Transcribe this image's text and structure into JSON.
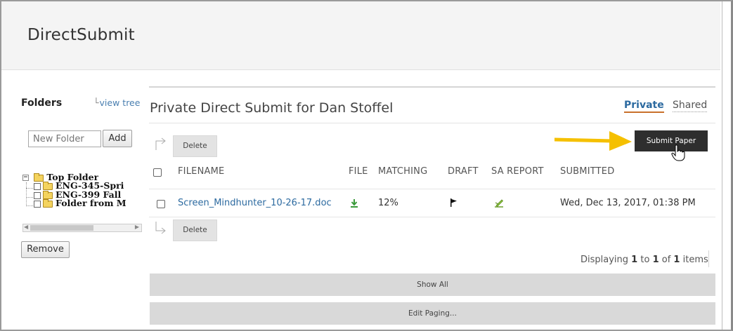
{
  "app": {
    "title": "DirectSubmit"
  },
  "sidebar": {
    "title": "Folders",
    "view_tree_label": "view tree",
    "new_folder_placeholder": "New Folder",
    "add_label": "Add",
    "remove_label": "Remove",
    "tree": {
      "root": "Top Folder",
      "children": [
        "ENG-345-Spri",
        "ENG-399 Fall",
        "Folder from M"
      ]
    }
  },
  "main": {
    "heading": "Private Direct Submit for Dan Stoffel",
    "tabs": [
      {
        "label": "Private",
        "active": true
      },
      {
        "label": "Shared",
        "active": false
      }
    ],
    "delete_label": "Delete",
    "submit_label": "Submit Paper",
    "columns": [
      "FILENAME",
      "FILE",
      "MATCHING",
      "DRAFT",
      "SA REPORT",
      "SUBMITTED"
    ],
    "rows": [
      {
        "filename": "Screen_Mindhunter_10-26-17.doc",
        "file_icon": "download-icon",
        "matching": "12%",
        "draft_icon": "flag-icon",
        "sa_report_icon": "sa-report-icon",
        "submitted": "Wed, Dec 13, 2017, 01:38 PM"
      }
    ],
    "paging": {
      "prefix": "Displaying",
      "from": "1",
      "to_word": "to",
      "to": "1",
      "of_word": "of",
      "total": "1",
      "suffix": "items"
    },
    "show_all_label": "Show All",
    "edit_paging_label": "Edit Paging..."
  },
  "colors": {
    "accent_link": "#2c6aa0",
    "tab_underline": "#c9702b",
    "submit_bg": "#2e2e2e",
    "highlight_arrow": "#f5c000"
  }
}
